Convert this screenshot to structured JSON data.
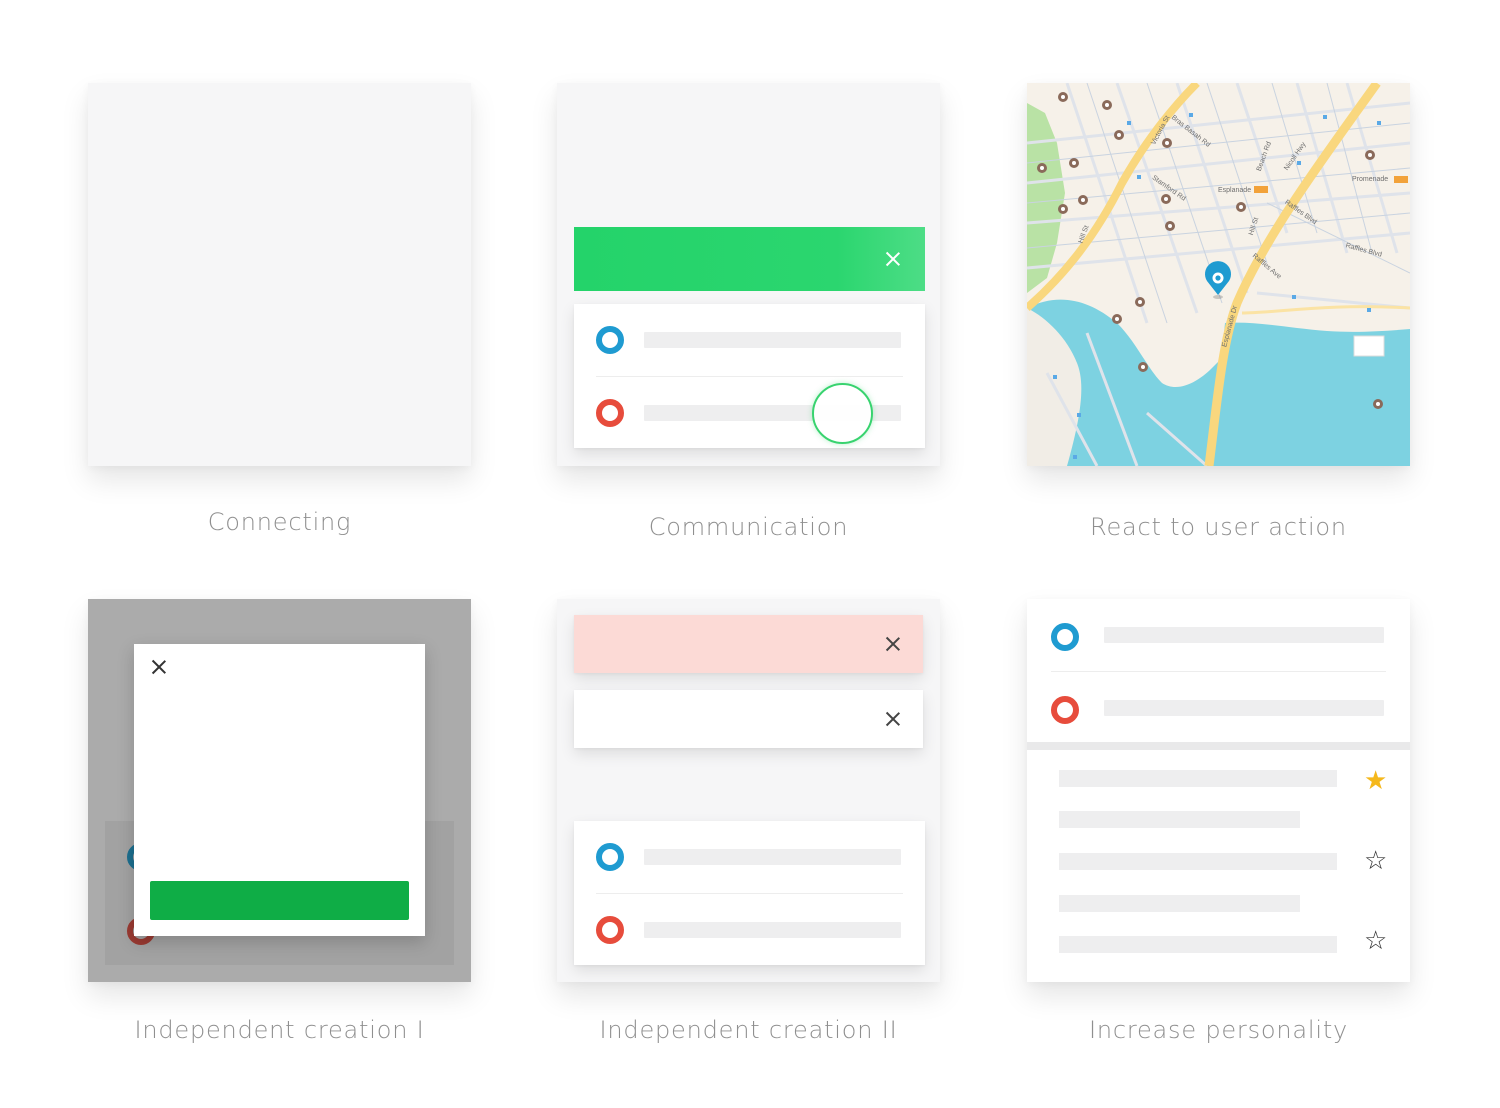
{
  "captions": {
    "connecting": "Connecting",
    "communication": "Communication",
    "react": "React to user action",
    "independent1": "Independent creation I",
    "independent2": "Independent creation II",
    "personality": "Increase personality"
  },
  "map": {
    "streets": [
      "Victoria St",
      "Bras Basah Rd",
      "Stamford Rd",
      "Beach Rd",
      "Nicoll Hwy",
      "Raffles Blvd",
      "Hill St",
      "Raffles Ave",
      "Esplanade Dr",
      "Promenade",
      "Esplanade"
    ]
  },
  "icons": {
    "close": "close-icon",
    "star_filled": "star-filled-icon",
    "star_outline": "star-outline-icon",
    "location_pin": "location-pin-icon",
    "radio_blue": "radio-blue-icon",
    "radio_red": "radio-red-icon"
  },
  "colors": {
    "green_banner": "#2bd66f",
    "green_button": "#0fad46",
    "red_banner": "#fcdad6",
    "blue_dot": "#1f9bd1",
    "red_dot": "#e74c3c",
    "star": "#f5b81c",
    "water": "#7dd2e1",
    "road_major": "#f9d77e"
  }
}
